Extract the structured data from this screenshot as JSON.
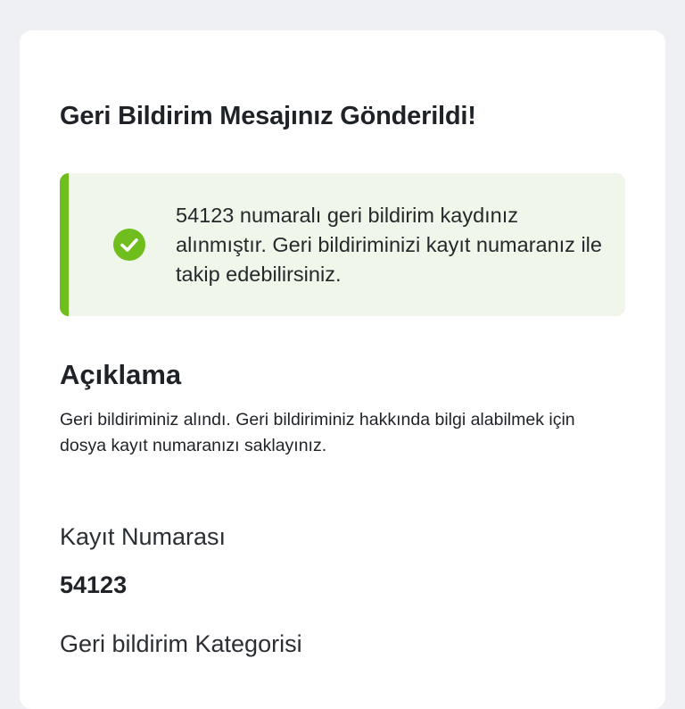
{
  "page": {
    "title": "Geri Bildirim Mesajınız Gönderildi!"
  },
  "alert": {
    "icon": "check-circle-icon",
    "color": "#6fbe1e",
    "message": "54123 numaralı geri bildirim kaydınız alınmıştır. Geri bildiriminizi kayıt numaranız ile takip edebilirsiniz."
  },
  "description": {
    "heading": "Açıklama",
    "text": "Geri bildiriminiz alındı. Geri bildiriminiz hakkında bilgi alabilmek için dosya kayıt numaranızı saklayınız."
  },
  "fields": [
    {
      "label": "Kayıt Numarası",
      "value": "54123"
    },
    {
      "label": "Geri bildirim Kategorisi",
      "value": ""
    }
  ]
}
